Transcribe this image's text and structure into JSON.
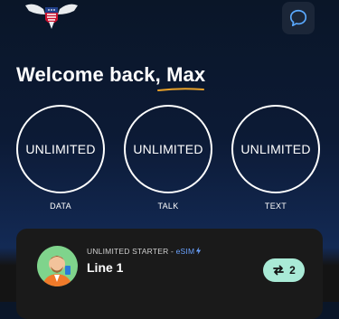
{
  "header": {
    "logo_icon": "eagle-shield-logo",
    "chat_icon": "chat-bubble-icon"
  },
  "welcome": {
    "greeting": "Welcome back, ",
    "name": "Max",
    "accent_color": "#e8a12a"
  },
  "usage": [
    {
      "value": "UNLIMITED",
      "label": "DATA"
    },
    {
      "value": "UNLIMITED",
      "label": "TALK"
    },
    {
      "value": "UNLIMITED",
      "label": "TEXT"
    }
  ],
  "line_card": {
    "plan": "UNLIMITED STARTER",
    "separator": " - ",
    "sim_type": "eSIM",
    "sim_icon": "bolt-icon",
    "line_name": "Line 1",
    "lines_count": "2",
    "lines_icon": "swap-arrows-icon"
  }
}
